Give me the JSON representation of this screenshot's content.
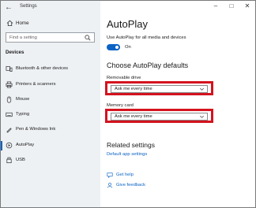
{
  "window": {
    "title": "Settings"
  },
  "sidebar": {
    "home_label": "Home",
    "search_placeholder": "Find a setting",
    "section_title": "Devices",
    "items": [
      {
        "label": "Bluetooth & other devices",
        "icon": "bluetooth-devices-icon"
      },
      {
        "label": "Printers & scanners",
        "icon": "printer-icon"
      },
      {
        "label": "Mouse",
        "icon": "mouse-icon"
      },
      {
        "label": "Typing",
        "icon": "keyboard-icon"
      },
      {
        "label": "Pen & Windows Ink",
        "icon": "pen-icon"
      },
      {
        "label": "AutoPlay",
        "icon": "autoplay-icon",
        "active": true
      },
      {
        "label": "USB",
        "icon": "usb-icon"
      }
    ]
  },
  "main": {
    "title": "AutoPlay",
    "toggle_description": "Use AutoPlay for all media and devices",
    "toggle_state": "On",
    "defaults_heading": "Choose AutoPlay defaults",
    "removable_label": "Removable drive",
    "removable_value": "Ask me every time",
    "memory_label": "Memory card",
    "memory_value": "Ask me every time",
    "related_heading": "Related settings",
    "related_link": "Default app settings",
    "help_link": "Get help",
    "feedback_link": "Give feedback"
  },
  "colors": {
    "accent": "#0b63c4",
    "highlight": "#d4131f",
    "sidebar_bg": "#eef1f4"
  }
}
